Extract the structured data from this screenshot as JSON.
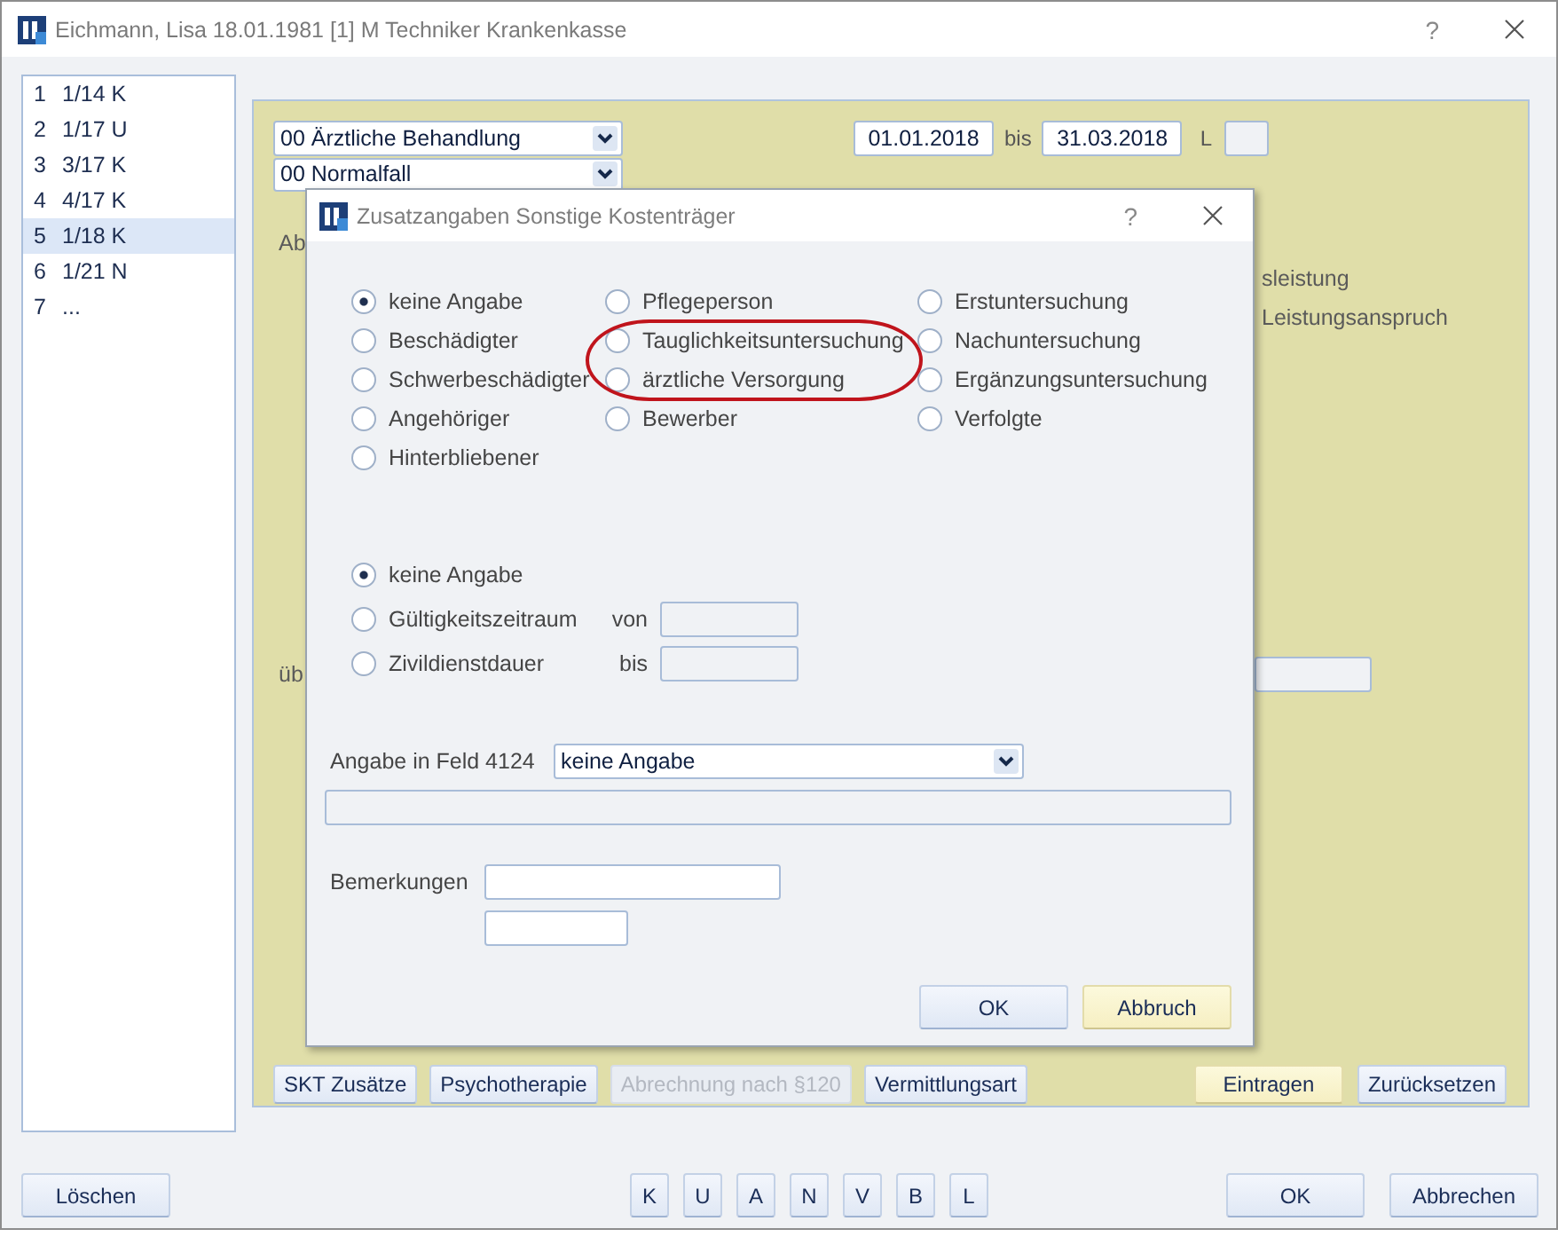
{
  "window": {
    "title": "Eichmann, Lisa 18.01.1981 [1] M Techniker Krankenkasse",
    "help": "?"
  },
  "cases": [
    {
      "number": "1",
      "label": "1/14 K",
      "selected": false
    },
    {
      "number": "2",
      "label": "1/17 U",
      "selected": false
    },
    {
      "number": "3",
      "label": "3/17 K",
      "selected": false
    },
    {
      "number": "4",
      "label": "4/17 K",
      "selected": false
    },
    {
      "number": "5",
      "label": "1/18 K",
      "selected": true
    },
    {
      "number": "6",
      "label": "1/21 N",
      "selected": false
    },
    {
      "number": "7",
      "label": "...",
      "selected": false
    }
  ],
  "form": {
    "treatment": {
      "value": "00 Ärztliche Behandlung"
    },
    "case_type": {
      "value": "00 Normalfall"
    },
    "date_from": "01.01.2018",
    "date_separator": "bis",
    "date_to": "31.03.2018",
    "l_label": "L",
    "left_label_1": "Ab",
    "right_label_1": "sleistung",
    "right_label_2": "Leistungsanspruch",
    "left_label_2": "üb",
    "buttons": [
      {
        "label": "SKT Zusätze",
        "disabled": false
      },
      {
        "label": "Psychotherapie",
        "disabled": false
      },
      {
        "label": "Abrechnung nach §120",
        "disabled": true
      },
      {
        "label": "Vermittlungsart",
        "disabled": false
      }
    ],
    "side_buttons": [
      {
        "label": "Eintragen",
        "default": true
      },
      {
        "label": "Zurücksetzen",
        "default": false
      }
    ]
  },
  "dialog": {
    "title": "Zusatzangaben Sonstige Kostenträger",
    "help": "?",
    "person_type": {
      "columns": [
        {
          "options": [
            {
              "label": "keine Angabe",
              "selected": true,
              "circled": false
            },
            {
              "label": "Beschädigter",
              "selected": false,
              "circled": false
            },
            {
              "label": "Schwerbeschädigter",
              "selected": false,
              "circled": false
            },
            {
              "label": "Angehöriger",
              "selected": false,
              "circled": false
            },
            {
              "label": "Hinterbliebener",
              "selected": false,
              "circled": false
            }
          ]
        },
        {
          "options": [
            {
              "label": "Pflegeperson",
              "selected": false,
              "circled": false
            },
            {
              "label": "Tauglichkeitsuntersuchung",
              "selected": false,
              "circled": true
            },
            {
              "label": "ärztliche Versorgung",
              "selected": false,
              "circled": true
            },
            {
              "label": "Bewerber",
              "selected": false,
              "circled": false
            }
          ]
        },
        {
          "options": [
            {
              "label": "Erstuntersuchung",
              "selected": false,
              "circled": false
            },
            {
              "label": "Nachuntersuchung",
              "selected": false,
              "circled": false
            },
            {
              "label": "Ergänzungsuntersuchung",
              "selected": false,
              "circled": false
            },
            {
              "label": "Verfolgte",
              "selected": false,
              "circled": false
            }
          ]
        }
      ]
    },
    "period": {
      "options": [
        {
          "label": "keine Angabe",
          "selected": true
        },
        {
          "label": "Gültigkeitszeitraum",
          "selected": false,
          "field_label": "von"
        },
        {
          "label": "Zivildienstdauer",
          "selected": false,
          "field_label": "bis"
        }
      ]
    },
    "field_4124": {
      "label": "Angabe in Feld 4124",
      "value": "keine Angabe"
    },
    "remarks": {
      "label": "Bemerkungen"
    },
    "buttons": [
      {
        "label": "OK",
        "default": false
      },
      {
        "label": "Abbruch",
        "default": true
      }
    ]
  },
  "footer": {
    "delete": "Löschen",
    "letters": [
      "K",
      "U",
      "A",
      "N",
      "V",
      "B",
      "L"
    ],
    "ok": "OK",
    "cancel": "Abbrechen"
  }
}
